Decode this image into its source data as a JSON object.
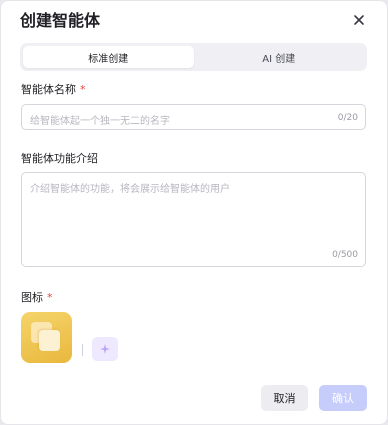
{
  "dialog": {
    "title": "创建智能体",
    "close_icon": "close-icon"
  },
  "tabs": [
    {
      "label": "标准创建",
      "active": true
    },
    {
      "label": "AI 创建",
      "active": false
    }
  ],
  "name_field": {
    "label": "智能体名称",
    "required_mark": "*",
    "placeholder": "给智能体起一个独一无二的名字",
    "counter": "0/20"
  },
  "intro_field": {
    "label": "智能体功能介绍",
    "placeholder": "介绍智能体的功能，将会展示给智能体的用户",
    "counter": "0/500"
  },
  "icon_field": {
    "label": "图标",
    "required_mark": "*",
    "magic_icon": "sparkle-icon"
  },
  "footer": {
    "cancel_label": "取消",
    "confirm_label": "确认"
  },
  "colors": {
    "accent_disabled": "#c7cdfb",
    "required": "#e8453c",
    "icon_tile": "#f0c64f",
    "magic_bg": "#efe9ff"
  }
}
